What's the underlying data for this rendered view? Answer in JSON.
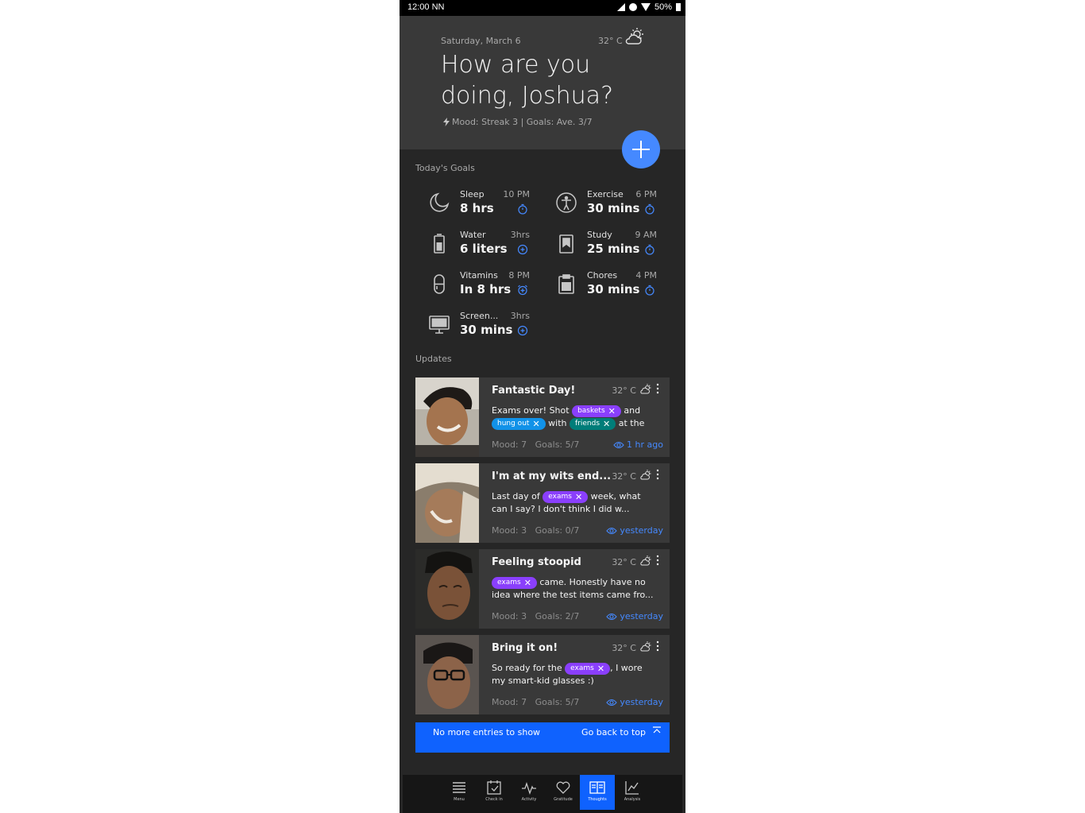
{
  "status_bar": {
    "time": "12:00 NN",
    "battery": "50%"
  },
  "header": {
    "date": "Saturday, March 6",
    "temperature": "32° C",
    "weather_icon": "partly-cloudy-icon",
    "greeting": "How are you doing, Joshua?",
    "stats": "Mood: Streak 3 | Goals: Ave. 3/7"
  },
  "add_button": {
    "icon": "plus-icon"
  },
  "goals": {
    "label": "Today's Goals",
    "items": [
      {
        "name": "Sleep",
        "time": "10 PM",
        "value": "8 hrs",
        "icon": "moon-icon",
        "action": "timer-icon"
      },
      {
        "name": "Exercise",
        "time": "6 PM",
        "value": "30 mins",
        "icon": "accessibility-icon",
        "action": "timer-icon"
      },
      {
        "name": "Water",
        "time": "3hrs",
        "value": "6 liters",
        "icon": "battery-icon",
        "action": "add-circle-icon"
      },
      {
        "name": "Study",
        "time": "9 AM",
        "value": "25 mins",
        "icon": "bookmark-icon",
        "action": "timer-icon"
      },
      {
        "name": "Vitamins",
        "time": "8 PM",
        "value": "In 8 hrs",
        "icon": "pill-icon",
        "action": "alarm-icon"
      },
      {
        "name": "Chores",
        "time": "4 PM",
        "value": "30 mins",
        "icon": "clipboard-icon",
        "action": "timer-icon"
      },
      {
        "name": "Screen...",
        "time": "3hrs",
        "value": "30 mins",
        "icon": "monitor-icon",
        "action": "add-circle-icon"
      }
    ]
  },
  "updates": {
    "label": "Updates",
    "entries": [
      {
        "title": "Fantastic Day!",
        "temperature": "32° C",
        "text_1": "Exams over! Shot",
        "tag_1": "baskets",
        "text_2": "and",
        "tag_2": "hung out",
        "text_3": "with",
        "tag_3": "friends",
        "text_4": "at the",
        "mood": "Mood: 7",
        "goals": "Goals: 5/7",
        "time_ago": "1 hr ago"
      },
      {
        "title": "I'm at my wits end...",
        "temperature": "32° C",
        "text_1": "Last day of",
        "tag_1": "exams",
        "text_2": "week, what can I say? I don't think I did w...",
        "mood": "Mood: 3",
        "goals": "Goals: 0/7",
        "time_ago": "yesterday"
      },
      {
        "title": "Feeling stoopid",
        "temperature": "32° C",
        "tag_1": "exams",
        "text_1": "came. Honestly have no idea where the test items came fro...",
        "mood": "Mood: 3",
        "goals": "Goals: 2/7",
        "time_ago": "yesterday"
      },
      {
        "title": "Bring it on!",
        "temperature": "32° C",
        "text_1": "So ready for the",
        "tag_1": "exams",
        "text_2": ", I wore my smart-kid glasses :)",
        "mood": "Mood: 7",
        "goals": "Goals: 5/7",
        "time_ago": "yesterday"
      }
    ]
  },
  "notice": {
    "message": "No more entries to show",
    "action": "Go back to top"
  },
  "bottom_nav": {
    "active": "Thoughts",
    "items": [
      "Menu",
      "Check in",
      "Activity",
      "Gratitude",
      "Thoughts",
      "Analysis"
    ]
  },
  "colors": {
    "accent": "#0f62fe",
    "fab": "#4589ff",
    "tag_purple": "#8a3ffc",
    "tag_cyan": "#1192e8",
    "tag_teal": "#007d79",
    "background": "#262626",
    "header": "#393939"
  }
}
